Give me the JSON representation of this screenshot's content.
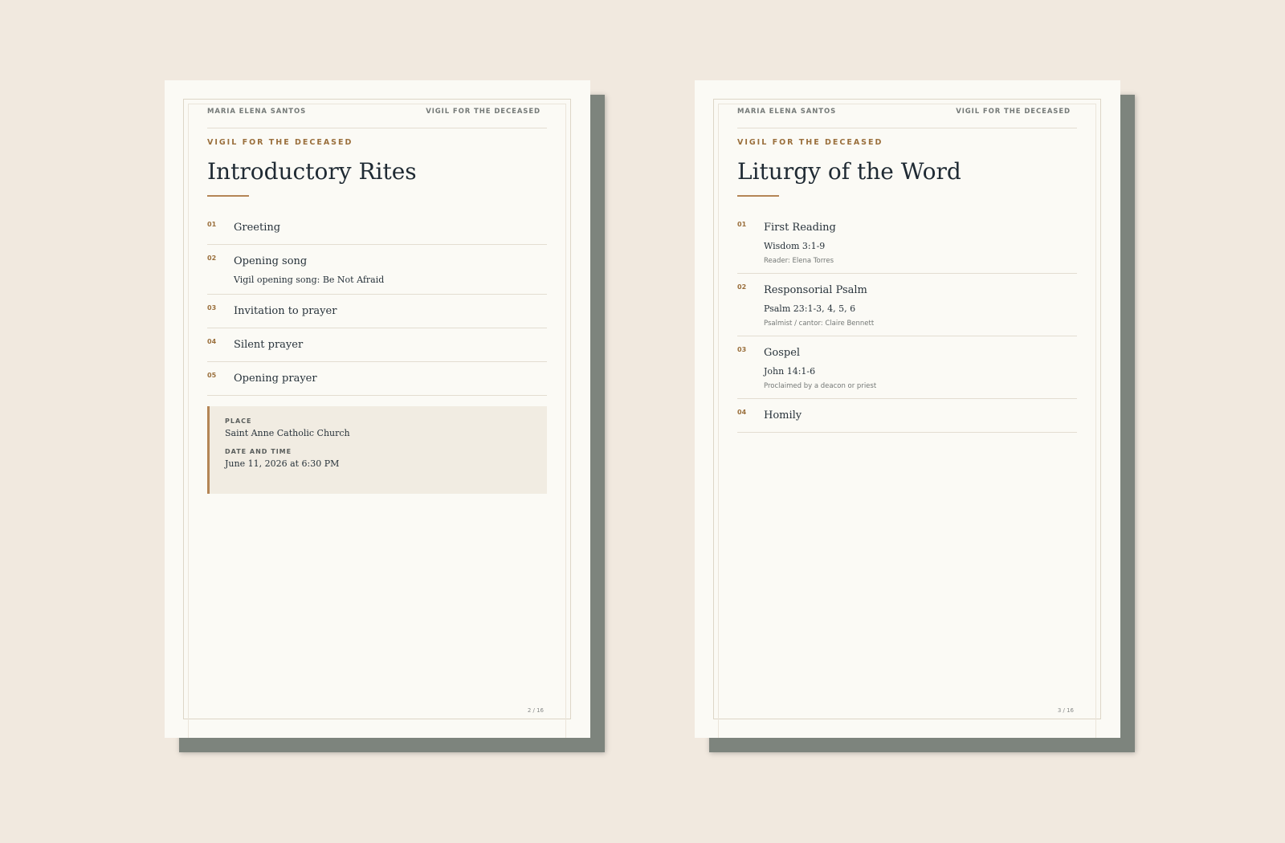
{
  "pages": [
    {
      "running_head_left": "MARIA ELENA SANTOS",
      "running_head_right": "VIGIL FOR THE DECEASED",
      "eyebrow": "VIGIL FOR THE DECEASED",
      "title": "Introductory Rites",
      "items": [
        {
          "num": "01",
          "label": "Greeting"
        },
        {
          "num": "02",
          "label": "Opening song",
          "sub": "Vigil opening song: Be Not Afraid"
        },
        {
          "num": "03",
          "label": "Invitation to prayer"
        },
        {
          "num": "04",
          "label": "Silent prayer"
        },
        {
          "num": "05",
          "label": "Opening prayer"
        }
      ],
      "info": {
        "place_label": "PLACE",
        "place_value": "Saint Anne Catholic Church",
        "date_label": "DATE AND TIME",
        "date_value": "June 11, 2026 at 6:30 PM"
      },
      "folio": "2 / 16"
    },
    {
      "running_head_left": "MARIA ELENA SANTOS",
      "running_head_right": "VIGIL FOR THE DECEASED",
      "eyebrow": "VIGIL FOR THE DECEASED",
      "title": "Liturgy of the Word",
      "items": [
        {
          "num": "01",
          "label": "First Reading",
          "sub": "Wisdom 3:1-9",
          "note": "Reader: Elena Torres"
        },
        {
          "num": "02",
          "label": "Responsorial Psalm",
          "sub": "Psalm 23:1-3, 4, 5, 6",
          "note": "Psalmist / cantor: Claire Bennett"
        },
        {
          "num": "03",
          "label": "Gospel",
          "sub": "John 14:1-6",
          "note": "Proclaimed by a deacon or priest"
        },
        {
          "num": "04",
          "label": "Homily"
        }
      ],
      "folio": "3 / 16"
    }
  ]
}
